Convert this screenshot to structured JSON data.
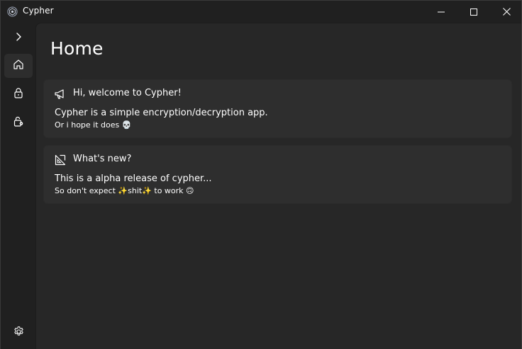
{
  "window": {
    "title": "Cypher",
    "controls": {
      "minimize": "minimize-icon",
      "maximize": "maximize-icon",
      "close": "close-icon"
    }
  },
  "sidebar": {
    "items": [
      {
        "name": "expand",
        "icon": "chevron-right-icon",
        "active": false
      },
      {
        "name": "home",
        "icon": "home-icon",
        "active": true
      },
      {
        "name": "encrypt",
        "icon": "lock-icon",
        "active": false
      },
      {
        "name": "decrypt",
        "icon": "unlock-key-icon",
        "active": false
      },
      {
        "name": "settings",
        "icon": "gear-icon",
        "active": false
      }
    ]
  },
  "main": {
    "page_title": "Home",
    "cards": [
      {
        "icon": "megaphone-icon",
        "title": "Hi, welcome to Cypher!",
        "body": "Cypher is a simple encryption/decryption app.",
        "sub": "Or i hope it does 💀"
      },
      {
        "icon": "new-icon",
        "title": "What's new?",
        "body": "This is a alpha release of cypher...",
        "sub": "So don't expect ✨shit✨ to work 🙃"
      }
    ]
  },
  "colors": {
    "window_bg": "#202020",
    "content_bg": "#272727",
    "card_bg": "#2e2e2e",
    "text": "#ffffff"
  }
}
